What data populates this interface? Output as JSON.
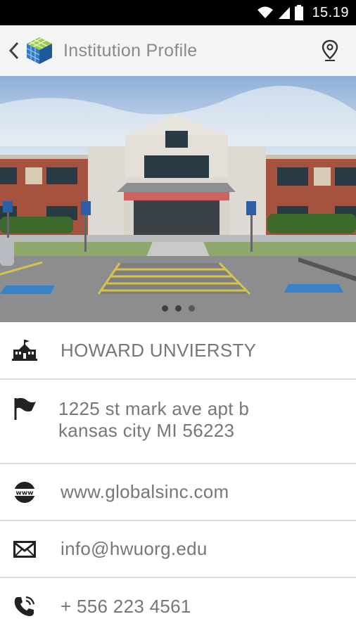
{
  "status_bar": {
    "time": "15.19"
  },
  "app_bar": {
    "title": "Institution Profile"
  },
  "carousel": {
    "total_pages": 3,
    "current_page": 2
  },
  "institution": {
    "name": "HOWARD UNVIERSTY",
    "address_line1": "1225 st mark ave apt b",
    "address_line2": "kansas city MI 56223",
    "website": "www.globalsinc.com",
    "email": "info@hwuorg.edu",
    "phone": "+ 556 223 4561"
  },
  "icons": {
    "name": "school-building-icon",
    "address": "flag-icon",
    "website": "www-globe-icon",
    "email": "envelope-icon",
    "phone": "phone-icon"
  },
  "colors": {
    "status_bar": "#000000",
    "app_bar": "#f4f4f4",
    "text": "#777777",
    "divider": "#dcdcdc"
  }
}
